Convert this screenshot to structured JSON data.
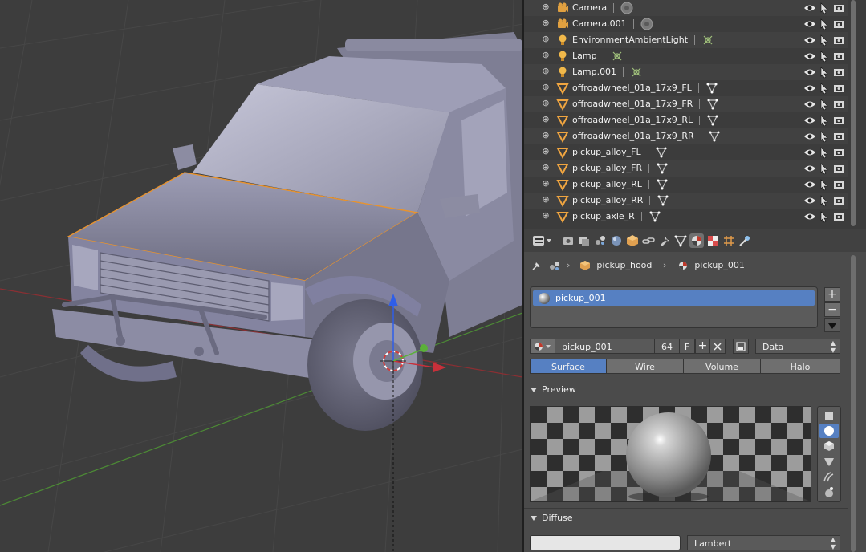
{
  "outliner": {
    "items": [
      {
        "name": "Camera",
        "type": "camera"
      },
      {
        "name": "Camera.001",
        "type": "camera"
      },
      {
        "name": "EnvironmentAmbientLight",
        "type": "lamp"
      },
      {
        "name": "Lamp",
        "type": "lamp"
      },
      {
        "name": "Lamp.001",
        "type": "lamp"
      },
      {
        "name": "offroadwheel_01a_17x9_FL",
        "type": "mesh"
      },
      {
        "name": "offroadwheel_01a_17x9_FR",
        "type": "mesh"
      },
      {
        "name": "offroadwheel_01a_17x9_RL",
        "type": "mesh"
      },
      {
        "name": "offroadwheel_01a_17x9_RR",
        "type": "mesh"
      },
      {
        "name": "pickup_alloy_FL",
        "type": "mesh"
      },
      {
        "name": "pickup_alloy_FR",
        "type": "mesh"
      },
      {
        "name": "pickup_alloy_RL",
        "type": "mesh"
      },
      {
        "name": "pickup_alloy_RR",
        "type": "mesh"
      },
      {
        "name": "pickup_axle_R",
        "type": "mesh"
      }
    ]
  },
  "properties": {
    "breadcrumb": {
      "object": "pickup_hood",
      "material": "pickup_001"
    },
    "slot_list": {
      "items": [
        "pickup_001"
      ]
    },
    "material_name": "pickup_001",
    "users_count": "64",
    "fake_user": "F",
    "link_dropdown": "Data",
    "type_tabs": [
      "Surface",
      "Wire",
      "Volume",
      "Halo"
    ],
    "active_type_tab": "Surface",
    "panels": {
      "preview": "Preview",
      "diffuse": "Diffuse"
    },
    "diffuse_shader": "Lambert"
  },
  "colors": {
    "accent": "#5680c2",
    "selection_outline": "#e8932e",
    "axis_x": "#c8303a",
    "axis_y": "#5bb03a",
    "axis_z": "#2f5ee8"
  }
}
